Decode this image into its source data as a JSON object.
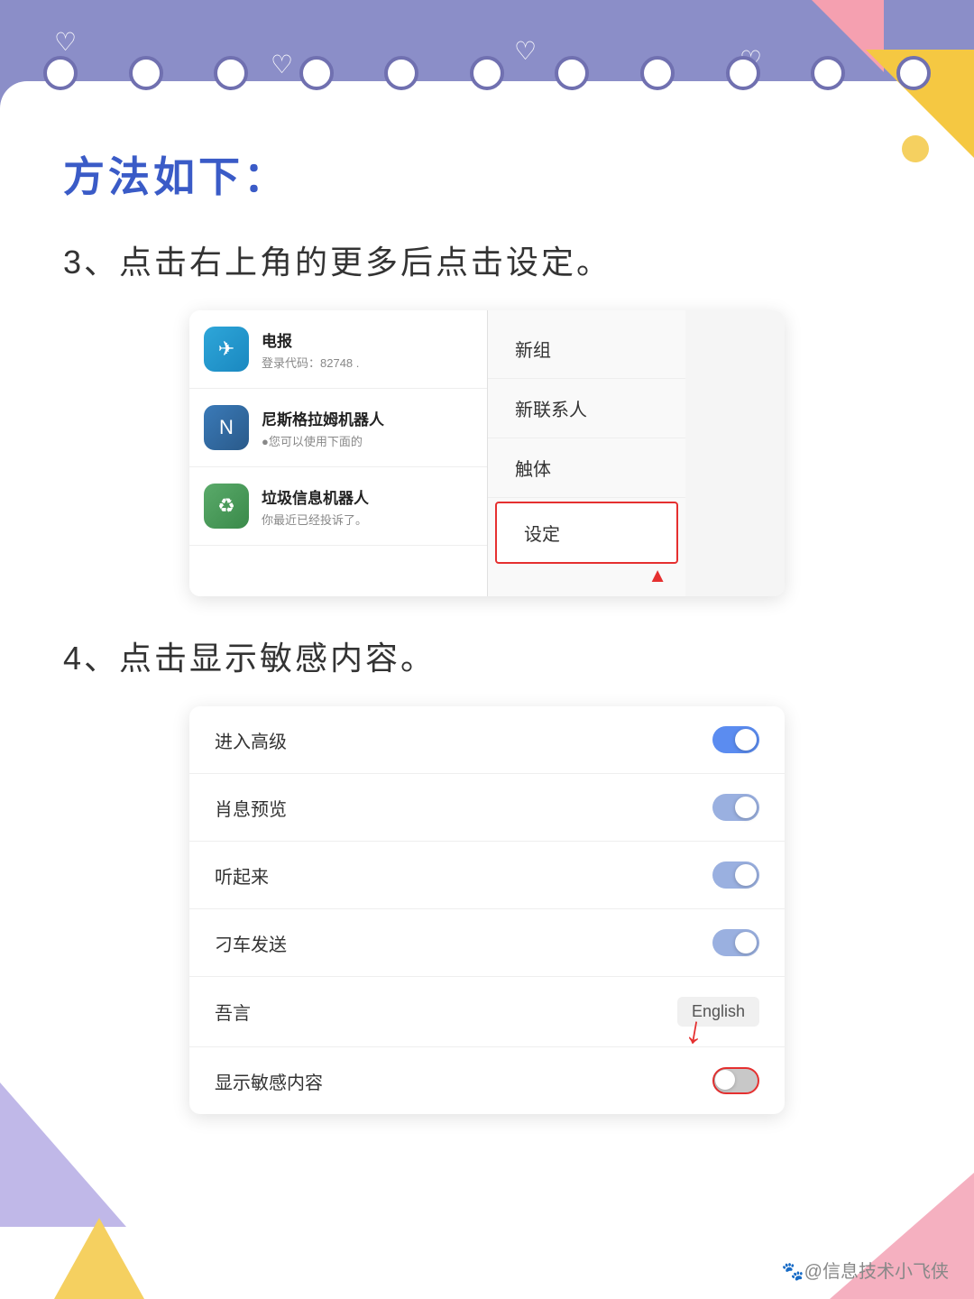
{
  "page": {
    "title": "Tutorial Page",
    "background": "#ffffff"
  },
  "header": {
    "band_color": "#8b8ec8"
  },
  "content": {
    "section_title": "方法如下：",
    "step3_text": "3、点击右上角的更多后点击设定。",
    "step4_text": "4、点击显示敏感内容。"
  },
  "menu_screenshot": {
    "app_items": [
      {
        "name": "电报",
        "desc": "登录代码：82748 .",
        "icon": "✈"
      },
      {
        "name": "尼斯格拉姆机器人",
        "desc": "●您可以使用下面的",
        "icon": "N"
      },
      {
        "name": "垃圾信息机器人",
        "desc": "你最近已经投诉了。",
        "icon": "♻"
      }
    ],
    "menu_items": [
      {
        "label": "新组",
        "highlighted": false
      },
      {
        "label": "新联系人",
        "highlighted": false
      },
      {
        "label": "触体",
        "highlighted": false
      },
      {
        "label": "设定",
        "highlighted": true
      }
    ]
  },
  "settings_screenshot": {
    "rows": [
      {
        "label": "进入高级",
        "type": "toggle",
        "state": "active"
      },
      {
        "label": "肖息预览",
        "type": "toggle",
        "state": "half"
      },
      {
        "label": "听起来",
        "type": "toggle",
        "state": "half"
      },
      {
        "label": "刁车发送",
        "type": "toggle",
        "state": "half"
      },
      {
        "label": "吾言",
        "type": "lang",
        "value": "English"
      },
      {
        "label": "显示敏感内容",
        "type": "toggle-highlighted",
        "state": "off"
      }
    ]
  },
  "watermark": {
    "text": "🐾@信息技术小飞侠"
  }
}
